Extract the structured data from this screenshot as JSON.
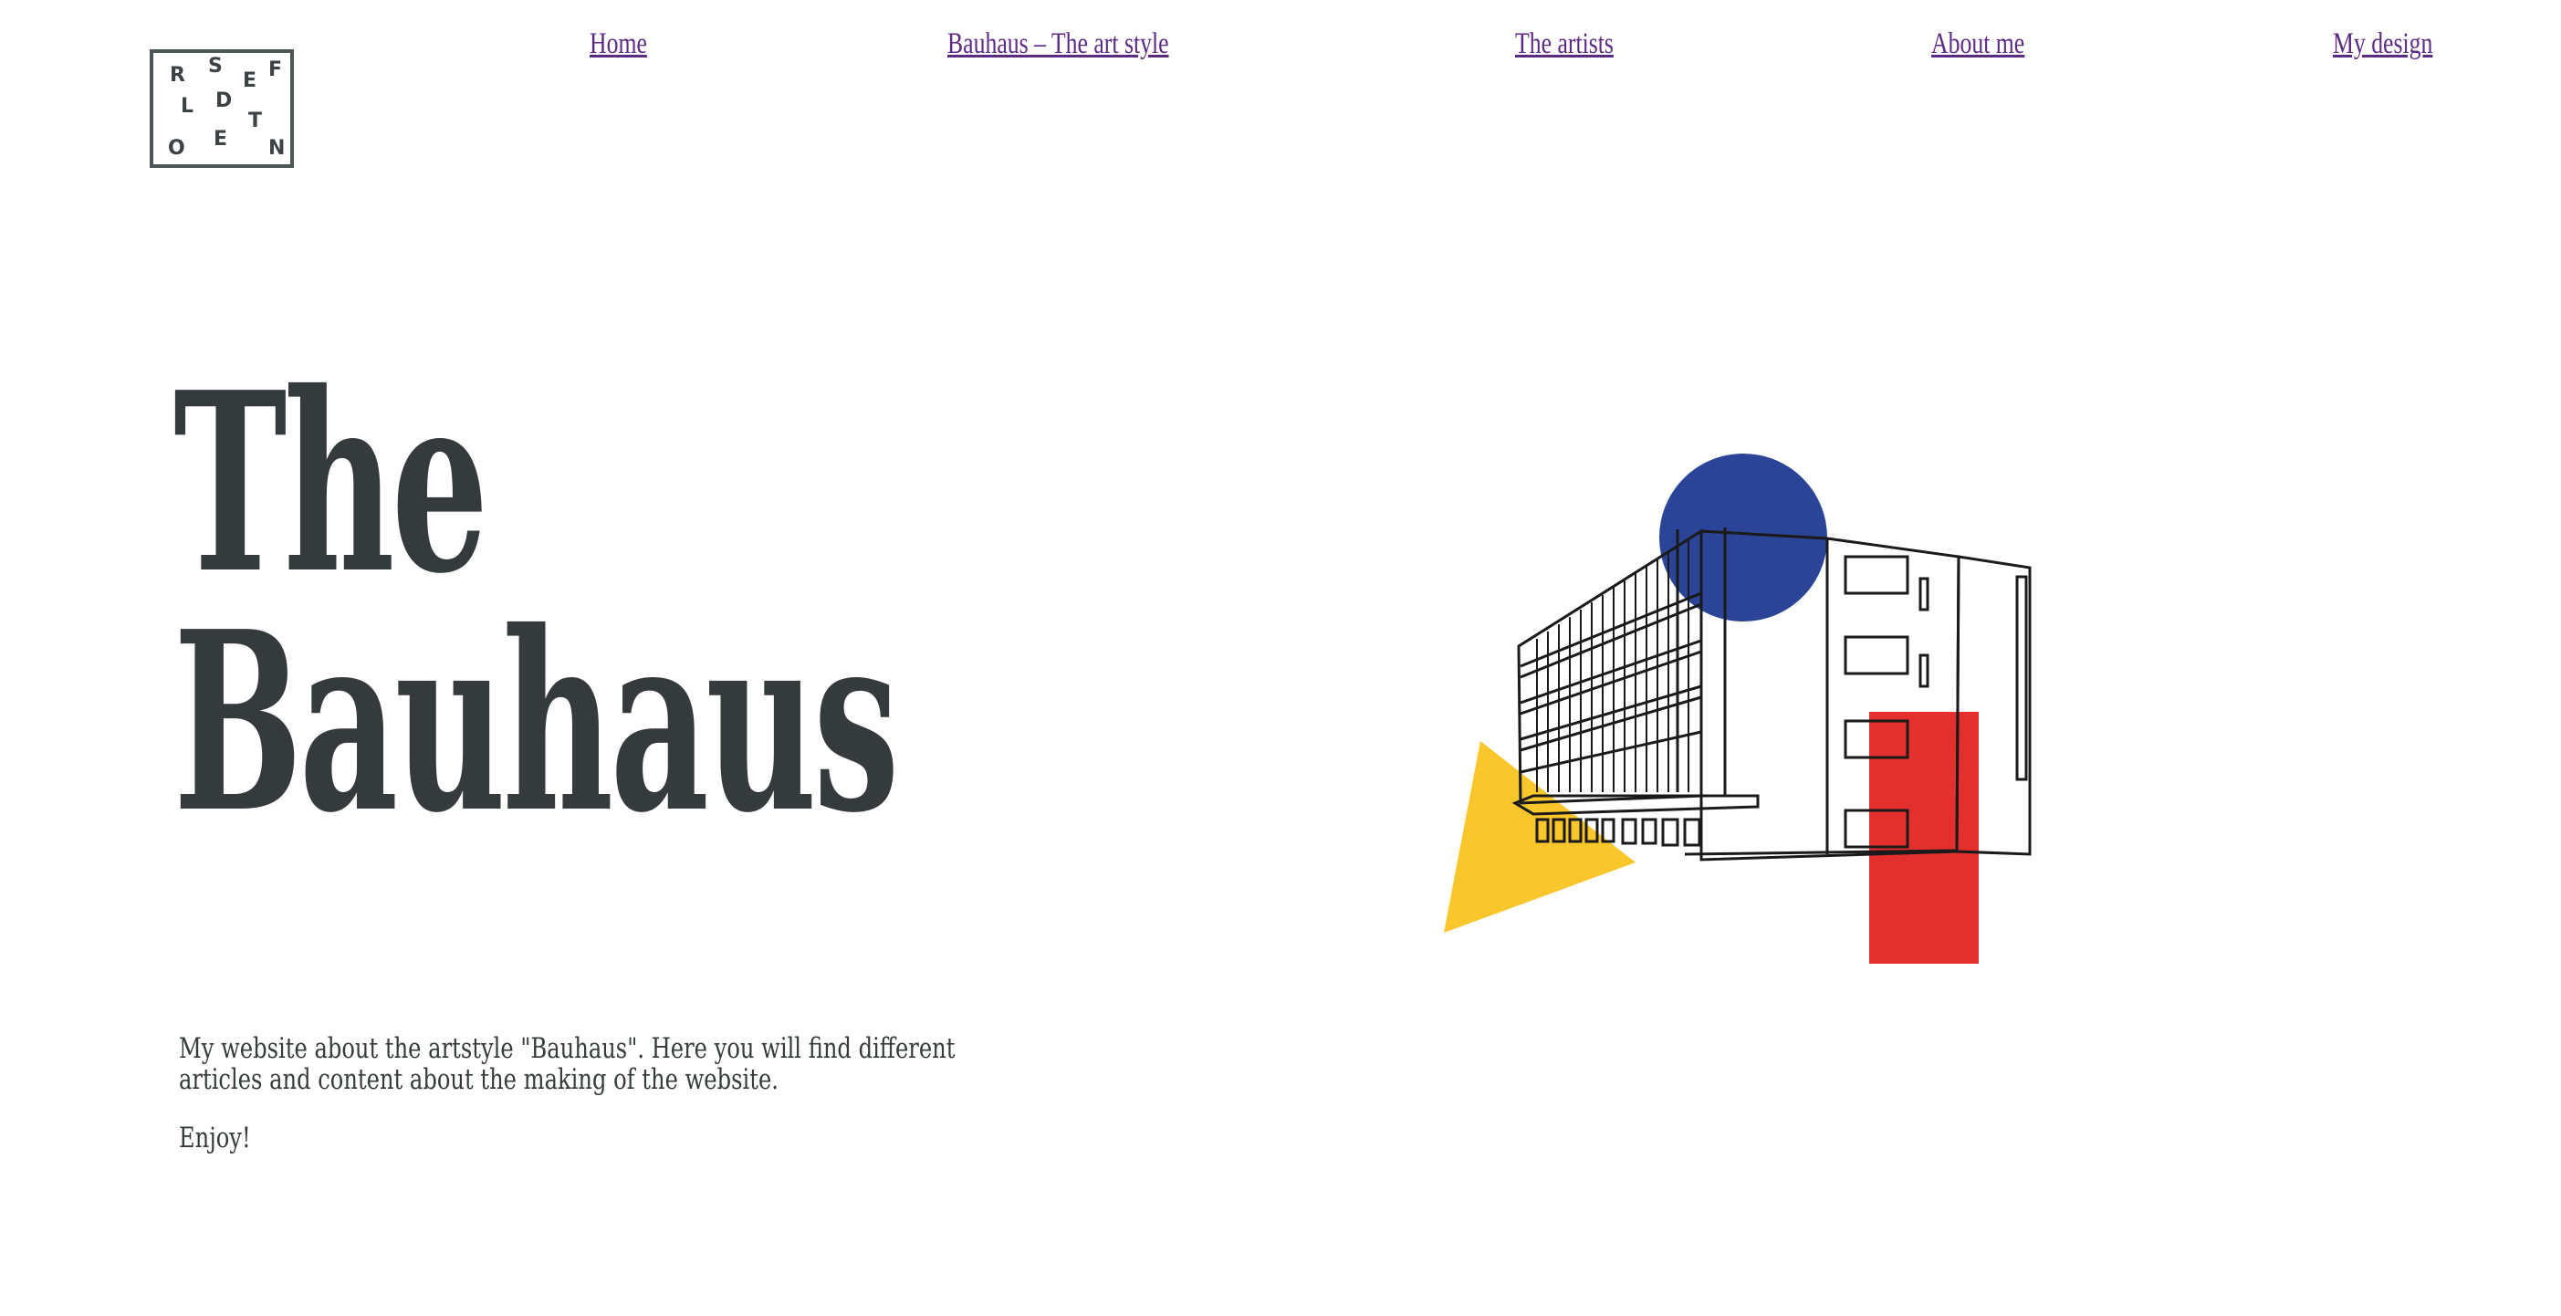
{
  "logo": {
    "letters": [
      "R",
      "S",
      "E",
      "F",
      "L",
      "D",
      "T",
      "O",
      "E",
      "N"
    ]
  },
  "nav": {
    "items": [
      {
        "label": "Home"
      },
      {
        "label": "Bauhaus – The art style"
      },
      {
        "label": "The artists"
      },
      {
        "label": "About me"
      },
      {
        "label": "My design"
      }
    ]
  },
  "hero": {
    "title_line1": "The",
    "title_line2": "Bauhaus",
    "intro": "My website about the artstyle \"Bauhaus\". Here you will find different articles and content about the making of the website.",
    "closing": "Enjoy!"
  },
  "colors": {
    "text": "#353b3c",
    "link": "#5b2a86",
    "circle": "#2b4497",
    "triangle": "#f9c62c",
    "rectangle": "#e3302e"
  }
}
